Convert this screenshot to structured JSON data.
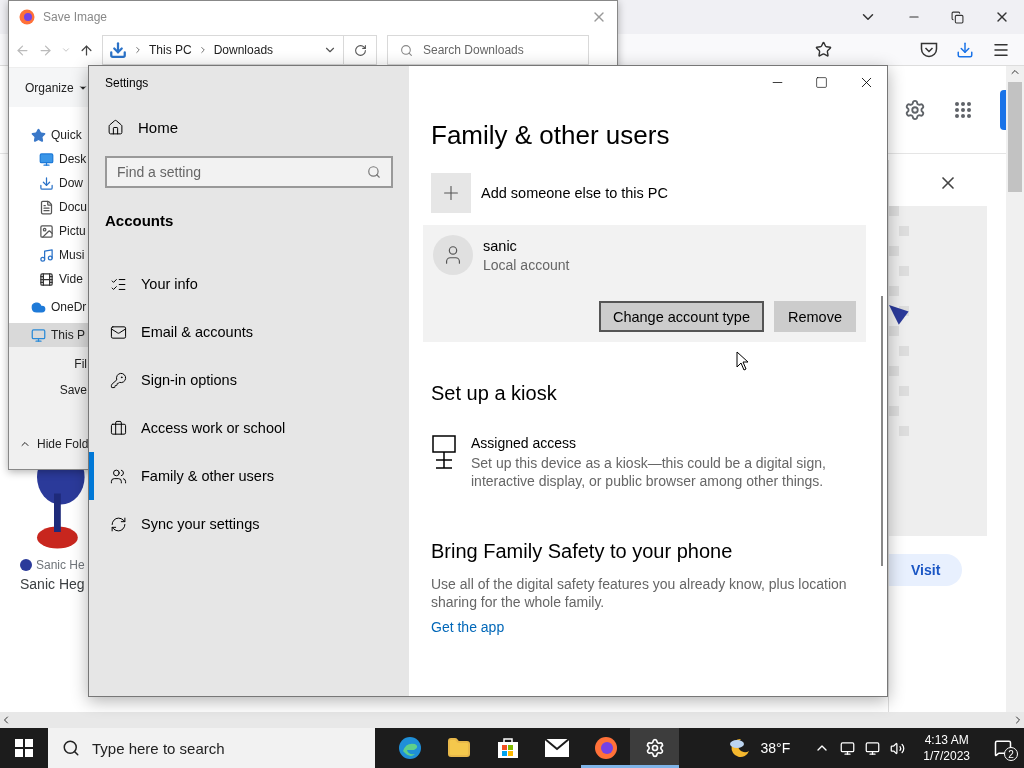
{
  "browser": {
    "visit_button": "Visit",
    "result_source": "Sanic He",
    "result_title": "Sanic Heg"
  },
  "save_dialog": {
    "title": "Save Image",
    "breadcrumb": [
      "This PC",
      "Downloads"
    ],
    "search": {
      "placeholder": "Search Downloads"
    },
    "organize": "Organize",
    "nav_items": [
      {
        "label": "Quick",
        "kind": "star",
        "selected": false
      },
      {
        "label": "Desk",
        "kind": "desktop",
        "selected": false
      },
      {
        "label": "Dow",
        "kind": "download",
        "selected": false
      },
      {
        "label": "Docu",
        "kind": "document",
        "selected": false
      },
      {
        "label": "Pictu",
        "kind": "pictures",
        "selected": false
      },
      {
        "label": "Musi",
        "kind": "music",
        "selected": false
      },
      {
        "label": "Vide",
        "kind": "videos",
        "selected": false
      },
      {
        "label": "OneDr",
        "kind": "cloud",
        "selected": false
      },
      {
        "label": "This P",
        "kind": "pc",
        "selected": true
      }
    ],
    "field_labels": [
      "Fil",
      "Save"
    ],
    "hide_folders": "Hide Fold"
  },
  "settings": {
    "title": "Settings",
    "home": "Home",
    "search": {
      "placeholder": "Find a setting"
    },
    "section": "Accounts",
    "nav_items": [
      {
        "label": "Your info",
        "kind": "info",
        "selected": false
      },
      {
        "label": "Email & accounts",
        "kind": "mail",
        "selected": false
      },
      {
        "label": "Sign-in options",
        "kind": "key",
        "selected": false
      },
      {
        "label": "Access work or school",
        "kind": "briefcase",
        "selected": false
      },
      {
        "label": "Family & other users",
        "kind": "people",
        "selected": true
      },
      {
        "label": "Sync your settings",
        "kind": "sync",
        "selected": false
      }
    ],
    "heading": "Family & other users",
    "add_user": "Add someone else to this PC",
    "user": {
      "name": "sanic",
      "type": "Local account",
      "expanded": true,
      "buttons": [
        {
          "label": "Change account type",
          "focused": true
        },
        {
          "label": "Remove",
          "focused": false
        }
      ]
    },
    "kiosk_heading": "Set up a kiosk",
    "kiosk_title": "Assigned access",
    "kiosk_text": "Set up this device as a kiosk—this could be a digital sign, interactive display, or public browser among other things.",
    "safety_heading": "Bring Family Safety to your phone",
    "safety_text": "Use all of the digital safety features you already know, plus location sharing for the whole family.",
    "safety_link": "Get the app"
  },
  "taskbar": {
    "search": {
      "placeholder": "Type here to search"
    },
    "apps": [
      {
        "kind": "edge",
        "open": false,
        "selected": false
      },
      {
        "kind": "folder",
        "open": false,
        "selected": false
      },
      {
        "kind": "store",
        "open": false,
        "selected": false
      },
      {
        "kind": "mail",
        "open": false,
        "selected": false
      },
      {
        "kind": "firefox",
        "open": true,
        "selected": false
      },
      {
        "kind": "settings",
        "open": true,
        "selected": true
      }
    ],
    "temperature": "38°F",
    "time": "4:13 AM",
    "date": "1/7/2023",
    "notifications": "2"
  }
}
